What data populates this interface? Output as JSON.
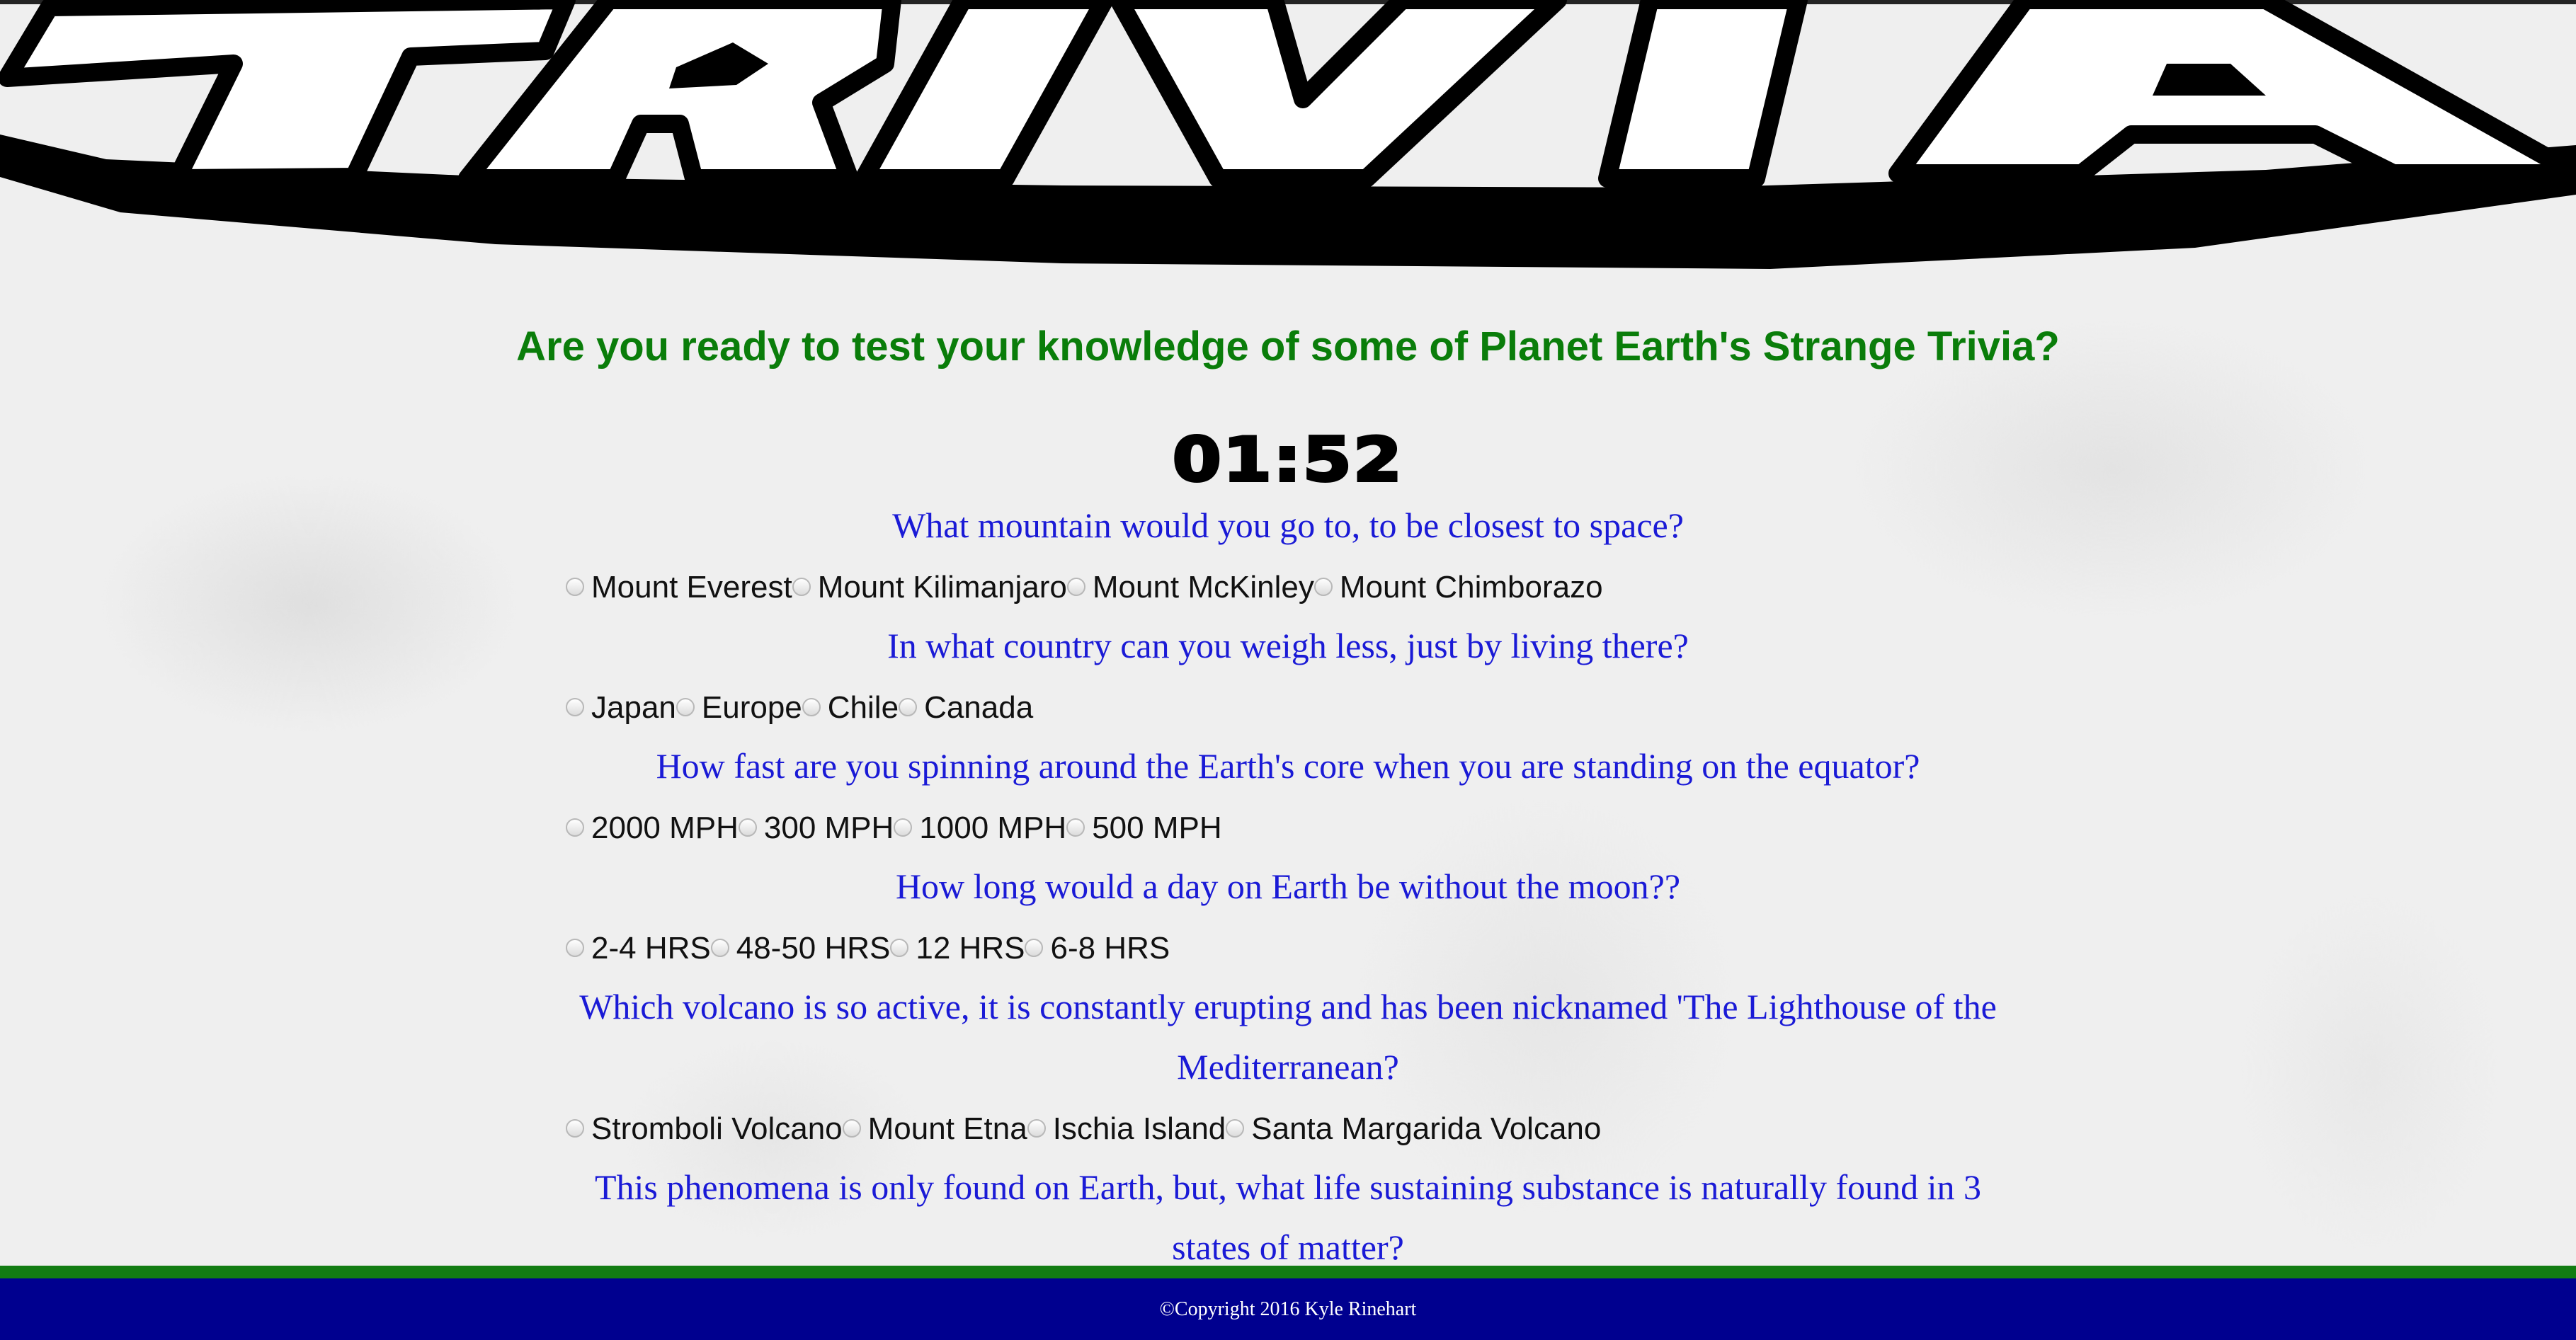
{
  "banner": {
    "logo_text": "TRIVIA"
  },
  "header": {
    "tagline": "Are you ready to test your knowledge of some of Planet Earth's Strange Trivia?"
  },
  "timer": {
    "value": "01:52"
  },
  "questions": [
    {
      "text": "What mountain would you go to, to be closest to space?",
      "options": [
        "Mount Everest",
        "Mount Kilimanjaro",
        "Mount McKinley",
        "Mount Chimborazo"
      ]
    },
    {
      "text": "In what country can you weigh less, just by living there?",
      "options": [
        "Japan",
        "Europe",
        "Chile",
        "Canada"
      ]
    },
    {
      "text": "How fast are you spinning around the Earth's core when you are standing on the equator?",
      "options": [
        "2000 MPH",
        "300 MPH",
        "1000 MPH",
        "500 MPH"
      ]
    },
    {
      "text": "How long would a day on Earth be without the moon??",
      "options": [
        "2-4 HRS",
        "48-50 HRS",
        "12 HRS",
        "6-8 HRS"
      ]
    },
    {
      "text": "Which volcano is so active, it is constantly erupting and has been nicknamed 'The Lighthouse of the Mediterranean?",
      "options": [
        "Stromboli Volcano",
        "Mount Etna",
        "Ischia Island",
        "Santa Margarida Volcano"
      ]
    },
    {
      "text": "This phenomena is only found on Earth, but, what life sustaining substance is naturally found in 3 states of matter?",
      "options": []
    }
  ],
  "footer": {
    "copyright": "©Copyright 2016 Kyle Rinehart"
  },
  "colors": {
    "tagline": "#0a7d0a",
    "question": "#1a1ad6",
    "footer_stripe": "#127c12",
    "footer_bar": "#00008f"
  }
}
